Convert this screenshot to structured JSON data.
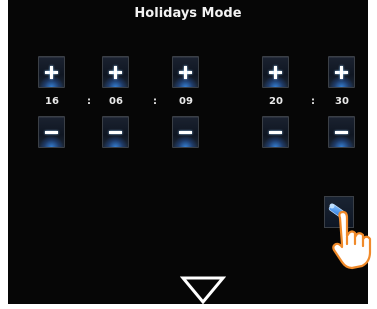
{
  "screen": {
    "title": "Holidays Mode"
  },
  "date": {
    "day": "16",
    "month": "06",
    "year": "09"
  },
  "time": {
    "hours": "20",
    "minutes": "30"
  },
  "separators": {
    "sep": ":"
  },
  "icons": {
    "increment": "plus-icon",
    "decrement": "minus-icon",
    "edit": "pencil-icon",
    "next": "down-triangle-icon",
    "pointer": "hand-pointer-icon"
  },
  "colors": {
    "background": "#060606",
    "accent_blue": "#3a8ae8",
    "text": "#e9e9e9",
    "arrow": "#ffffff"
  }
}
